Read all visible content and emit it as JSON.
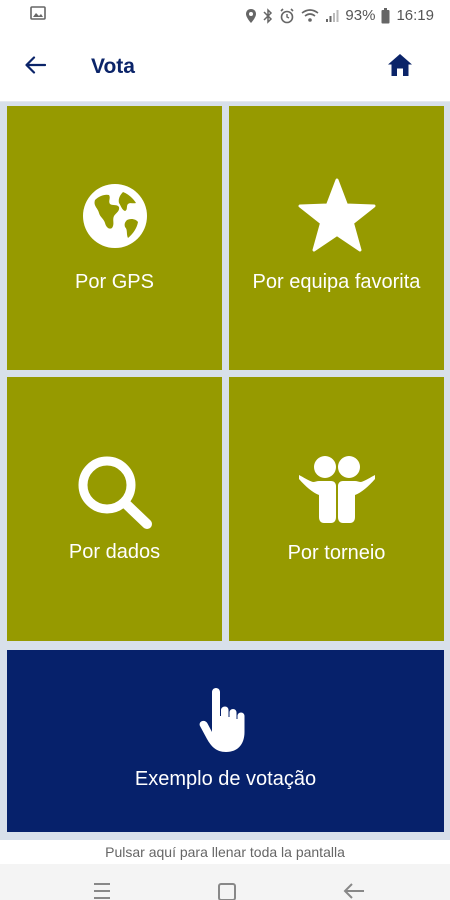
{
  "status": {
    "battery": "93%",
    "time": "16:19"
  },
  "header": {
    "title": "Vota"
  },
  "tiles": [
    {
      "label": "Por GPS",
      "icon": "globe-icon"
    },
    {
      "label": "Por equipa favorita",
      "icon": "star-icon"
    },
    {
      "label": "Por dados",
      "icon": "search-icon"
    },
    {
      "label": "Por torneio",
      "icon": "people-icon"
    }
  ],
  "example": {
    "label": "Exemplo de votação",
    "icon": "tap-hand-icon"
  },
  "hint": "Pulsar aquí para llenar toda la pantalla",
  "colors": {
    "tile": "#969a00",
    "example": "#06216b",
    "title": "#0b2469"
  }
}
